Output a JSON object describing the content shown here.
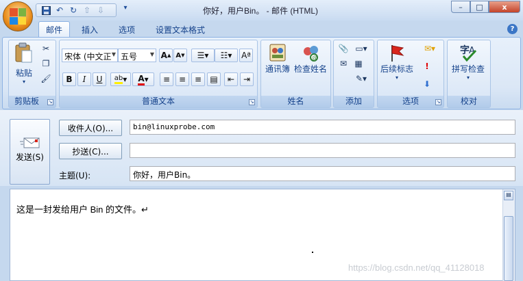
{
  "window": {
    "title": "你好，用户Bin。 - 邮件 (HTML)"
  },
  "title_controls": {
    "minimize": "–",
    "maximize": "□",
    "close": "x"
  },
  "quick_access": {
    "more": "▾"
  },
  "tabs": [
    {
      "label": "邮件",
      "active": true
    },
    {
      "label": "插入",
      "active": false
    },
    {
      "label": "选项",
      "active": false
    },
    {
      "label": "设置文本格式",
      "active": false
    }
  ],
  "ribbon": {
    "clipboard": {
      "group_label": "剪贴板",
      "paste_label": "粘贴"
    },
    "basic_text": {
      "group_label": "普通文本",
      "font_name": "宋体 (中文正",
      "font_size": "五号",
      "bold": "B",
      "italic": "I",
      "underline": "U"
    },
    "names": {
      "group_label": "姓名",
      "address_book": "通讯簿",
      "check_names": "检查姓名"
    },
    "include": {
      "group_label": "添加"
    },
    "options": {
      "group_label": "选项",
      "follow_up": "后续标志"
    },
    "proofing": {
      "group_label": "校对",
      "spelling": "拼写检查"
    }
  },
  "message": {
    "send_label": "发送(S)",
    "to_button": "收件人(O)...",
    "cc_button": "抄送(C)...",
    "subject_label": "主题(U):",
    "to_value": "bin@linuxprobe.com",
    "cc_value": "",
    "subject_value": "你好，用户Bin。",
    "body_text": "这是一封发给用户 Bin 的文件。↵"
  },
  "watermark": "https://blog.csdn.net/qq_41128018",
  "colors": {
    "accent": "#15428b",
    "ribbon_bg": "#dbe7f6",
    "close": "#c4432a"
  }
}
